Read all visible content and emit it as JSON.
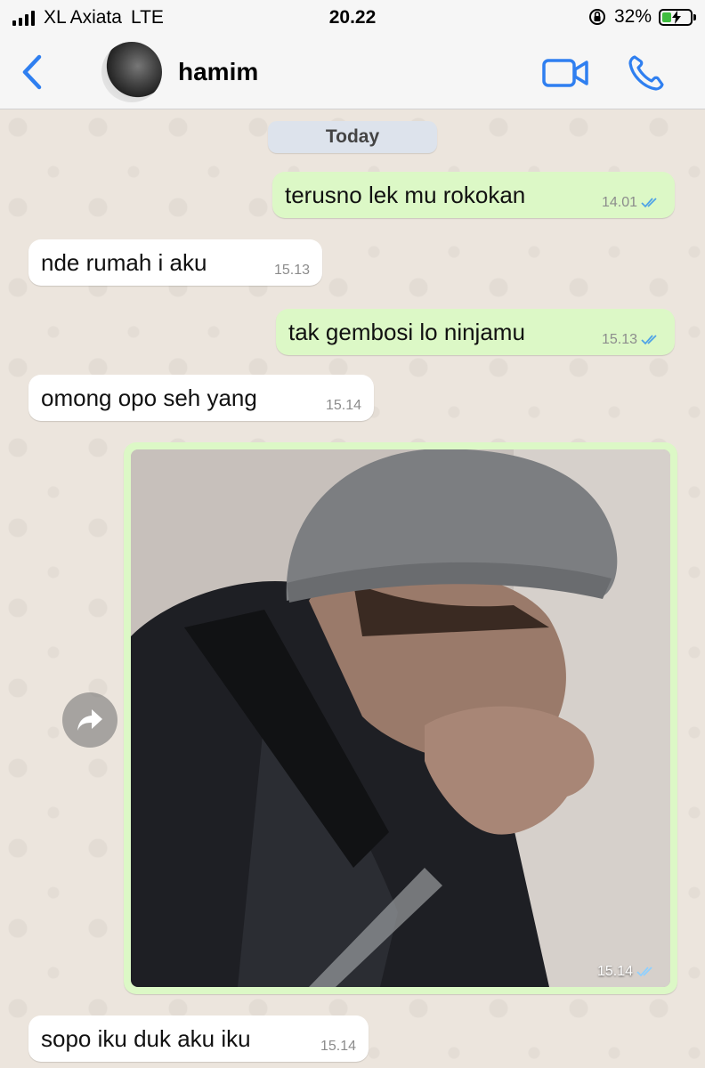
{
  "status_bar": {
    "carrier": "XL Axiata",
    "network": "LTE",
    "time": "20.22",
    "battery_percent": "32%",
    "battery_level": 0.32,
    "battery_color": "#3fbd3f"
  },
  "header": {
    "contact_name": "hamim",
    "accent_color": "#2f7ff0",
    "icons": [
      "chevron-left-icon",
      "avatar",
      "video-camera-icon",
      "phone-icon"
    ]
  },
  "chat": {
    "date_label": "Today",
    "messages": [
      {
        "direction": "out",
        "text": "terusno lek mu rokokan",
        "time": "14.01",
        "read": true
      },
      {
        "direction": "in",
        "text": "nde rumah i aku",
        "time": "15.13"
      },
      {
        "direction": "out",
        "text": "tak gembosi lo ninjamu",
        "time": "15.13",
        "read": true
      },
      {
        "direction": "in",
        "text": "omong opo seh yang",
        "time": "15.14"
      },
      {
        "direction": "out",
        "type": "image",
        "time": "15.14",
        "read": true
      },
      {
        "direction": "in",
        "text": "sopo iku duk aku iku",
        "time": "15.14"
      }
    ]
  }
}
